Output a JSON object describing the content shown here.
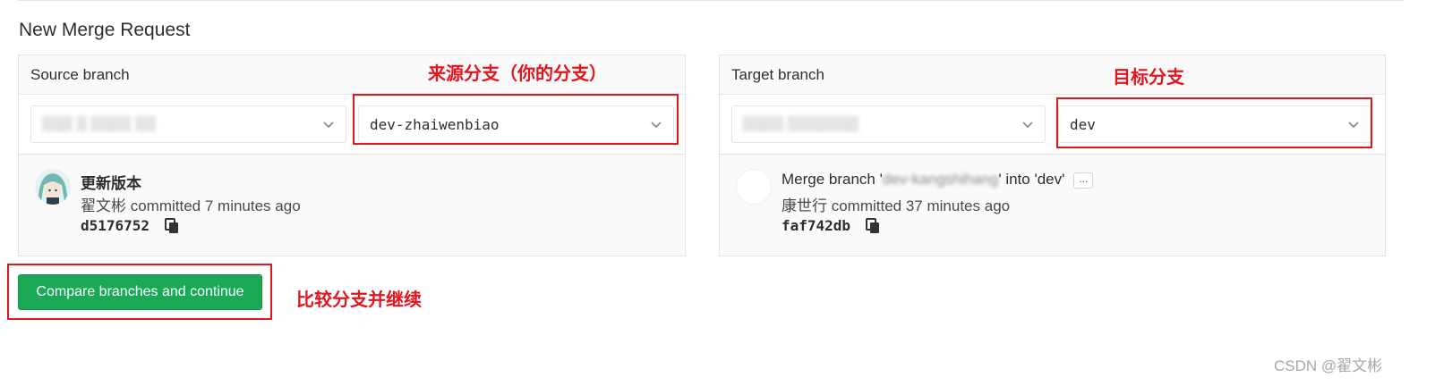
{
  "page": {
    "title": "New Merge Request"
  },
  "source": {
    "header": "Source branch",
    "project_value": "▒▒▒ ▒ ▒▒▒▒ ▒▒",
    "branch_value": "dev-zhaiwenbiao",
    "commit": {
      "message": "更新版本",
      "meta": "翟文彬 committed 7 minutes ago",
      "sha": "d5176752"
    },
    "annotation": "来源分支（你的分支）"
  },
  "target": {
    "header": "Target branch",
    "project_value": "▒▒▒▒ ▒▒▒▒▒▒▒",
    "branch_value": "dev",
    "commit": {
      "message_prefix": "Merge branch '",
      "message_blurred": "dev-kangshihang",
      "message_suffix": "' into 'dev'",
      "ellipsis": "...",
      "meta": "康世行 committed 37 minutes ago",
      "sha": "faf742db"
    },
    "annotation": "目标分支"
  },
  "actions": {
    "compare_label": "Compare branches and continue",
    "compare_annotation": "比较分支并继续"
  },
  "watermark": "CSDN @翟文彬",
  "colors": {
    "accent_green": "#1aaa55",
    "annotation_red": "#e3151e",
    "border": "#e5e5e5",
    "panel_bg": "#fafafa"
  },
  "icons": [
    "chevron-down-icon",
    "copy-icon",
    "avatar"
  ]
}
